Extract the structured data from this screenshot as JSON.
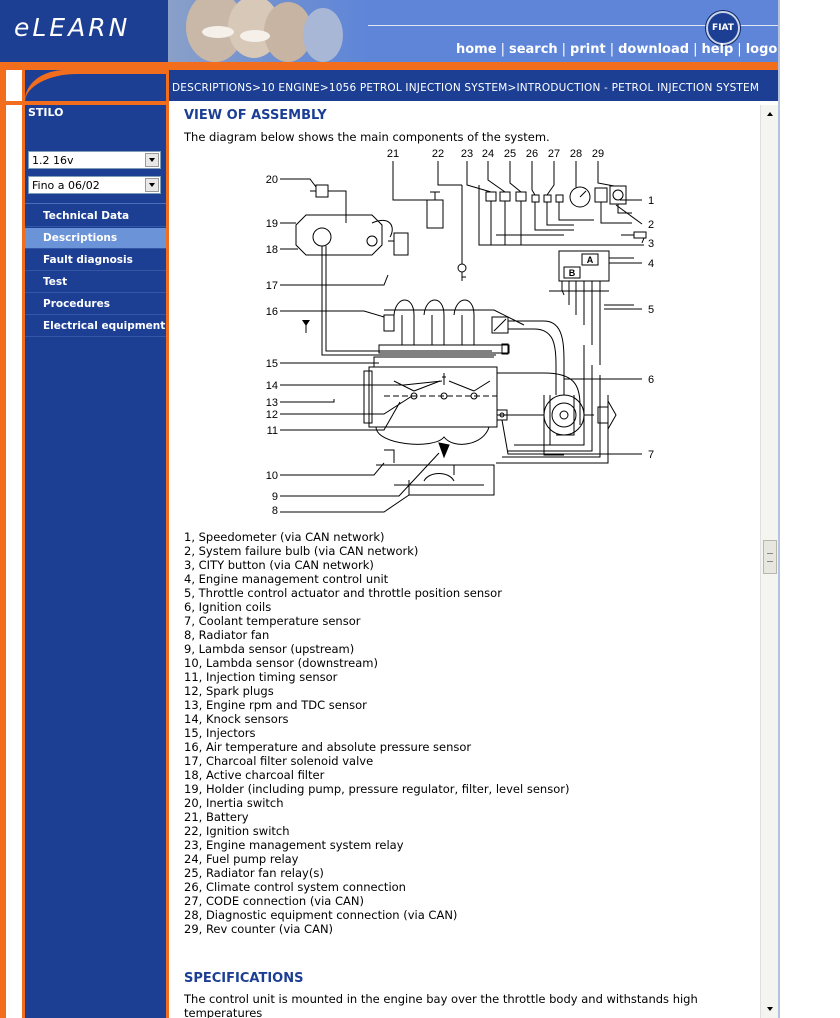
{
  "app": {
    "logo": "eLEARN",
    "brand_badge": "FIAT"
  },
  "top_nav": [
    {
      "label": "home"
    },
    {
      "label": "search"
    },
    {
      "label": "print"
    },
    {
      "label": "download"
    },
    {
      "label": "help"
    },
    {
      "label": "logout"
    }
  ],
  "breadcrumb": "DESCRIPTIONS>10 ENGINE>1056 PETROL INJECTION SYSTEM>INTRODUCTION - PETROL INJECTION SYSTEM",
  "sidebar": {
    "model": "STILO",
    "engine_select": "1.2 16v",
    "date_select": "Fino a 06/02",
    "items": [
      {
        "label": "Technical Data",
        "active": false
      },
      {
        "label": "Descriptions",
        "active": true
      },
      {
        "label": "Fault diagnosis",
        "active": false
      },
      {
        "label": "Test",
        "active": false
      },
      {
        "label": "Procedures",
        "active": false
      },
      {
        "label": "Electrical equipment",
        "active": false
      }
    ]
  },
  "content": {
    "section_title": "VIEW OF ASSEMBLY",
    "intro": "The diagram below shows the main components of the system.",
    "diagram_labels": {
      "top": [
        "21",
        "22",
        "23",
        "24",
        "25",
        "26",
        "27",
        "28",
        "29"
      ],
      "left": [
        "20",
        "19",
        "18",
        "17",
        "16",
        "15",
        "14",
        "13",
        "12",
        "11",
        "10",
        "9",
        "8"
      ],
      "right": [
        "1",
        "2",
        "3",
        "4",
        "5",
        "6",
        "7"
      ],
      "ecu_a": "A",
      "ecu_b": "B"
    },
    "legend": [
      "1, Speedometer (via CAN network)",
      "2, System failure bulb (via CAN network)",
      "3, CITY button (via CAN network)",
      "4, Engine management control unit",
      "5, Throttle control actuator and throttle position sensor",
      "6, Ignition coils",
      "7, Coolant temperature sensor",
      "8, Radiator fan",
      "9, Lambda sensor (upstream)",
      "10, Lambda sensor (downstream)",
      "11, Injection timing sensor",
      "12, Spark plugs",
      "13, Engine rpm and TDC sensor",
      "14, Knock sensors",
      "15, Injectors",
      "16, Air temperature and absolute pressure sensor",
      "17, Charcoal filter solenoid valve",
      "18, Active charcoal filter",
      "19, Holder (including pump, pressure regulator, filter, level sensor)",
      "20, Inertia switch",
      "21, Battery",
      "22, Ignition switch",
      "23, Engine management system relay",
      "24, Fuel pump relay",
      "25, Radiator fan relay(s)",
      "26, Climate control system connection",
      "27, CODE connection (via CAN)",
      "28, Diagnostic equipment connection (via CAN)",
      "29, Rev counter (via CAN)"
    ],
    "spec_title": "SPECIFICATIONS",
    "spec_text": "The control unit is mounted in the engine bay over the throttle body and withstands high temperatures"
  },
  "colors": {
    "navy": "#1c3f94",
    "orange": "#f26e1c",
    "active_item": "#6b94d8",
    "header_blue": "#5e85d8"
  }
}
